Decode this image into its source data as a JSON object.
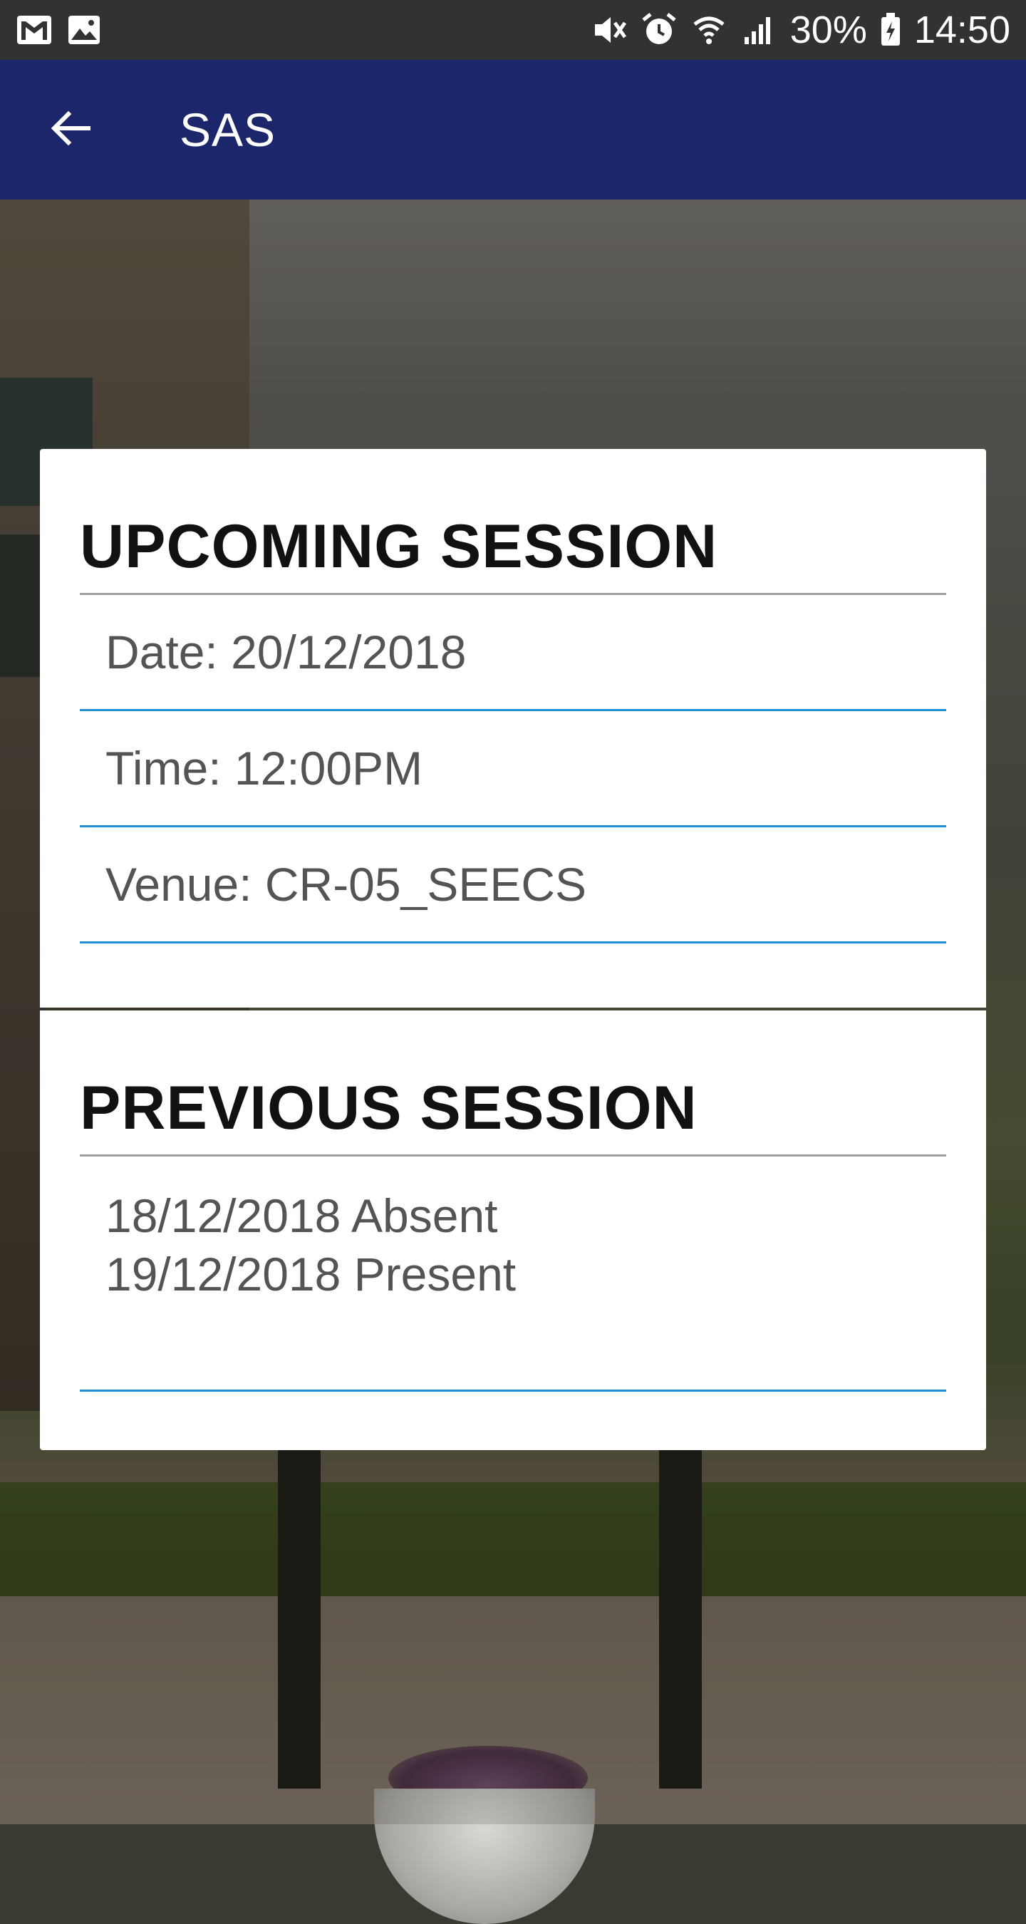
{
  "status_bar": {
    "battery": "30%",
    "time": "14:50",
    "icons": [
      "gmail-icon",
      "image-icon",
      "mute-icon",
      "alarm-icon",
      "wifi-icon",
      "signal-icon",
      "battery-charging-icon"
    ]
  },
  "app_bar": {
    "title": "SAS",
    "back_icon": "arrow-back-icon",
    "color": "#1b276a"
  },
  "upcoming": {
    "title": "UPCOMING SESSION",
    "date": "Date: 20/12/2018",
    "time": "Time: 12:00PM",
    "venue": "Venue: CR-05_SEECS"
  },
  "previous": {
    "title": "PREVIOUS SESSION",
    "entries": [
      "18/12/2018 Absent",
      "19/12/2018 Present"
    ]
  },
  "colors": {
    "accent_line": "#1e8fd0",
    "status_bar": "#323232"
  }
}
